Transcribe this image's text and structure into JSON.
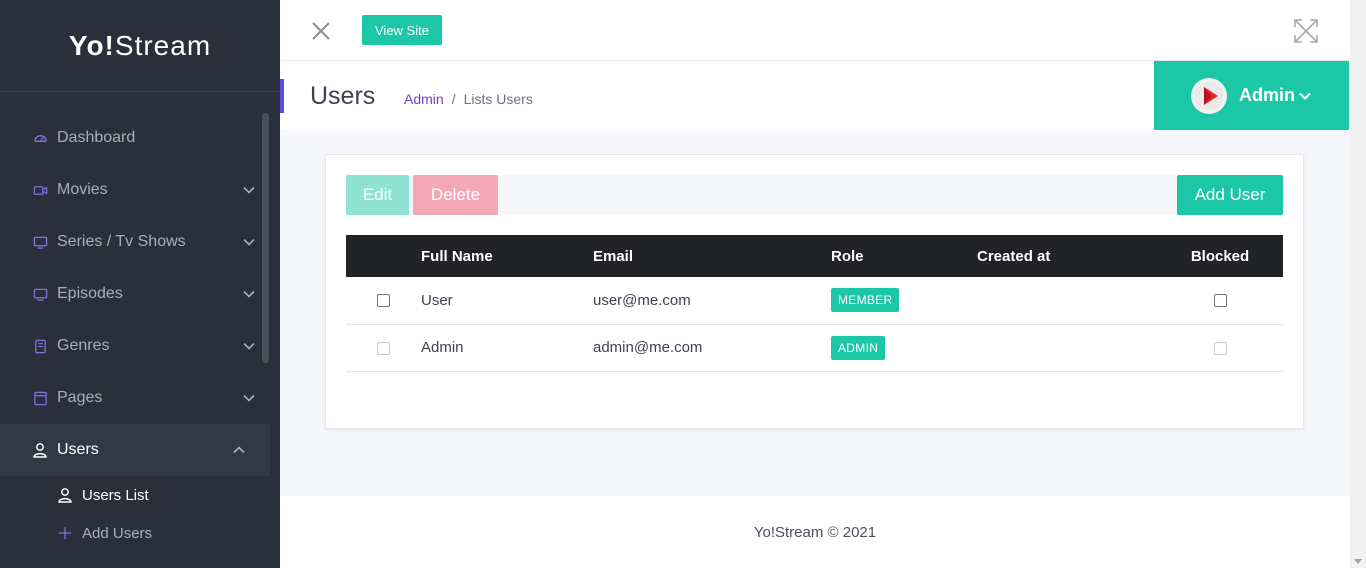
{
  "brand": {
    "bold": "Yo!",
    "rest": "Stream"
  },
  "sidebar": {
    "items": [
      {
        "label": "Dashboard",
        "icon": "dashboard-icon",
        "expandable": false
      },
      {
        "label": "Movies",
        "icon": "video-camera-icon",
        "expandable": true
      },
      {
        "label": "Series / Tv Shows",
        "icon": "monitor-icon",
        "expandable": true
      },
      {
        "label": "Episodes",
        "icon": "monitor-icon",
        "expandable": true
      },
      {
        "label": "Genres",
        "icon": "book-icon",
        "expandable": true
      },
      {
        "label": "Pages",
        "icon": "page-icon",
        "expandable": true
      },
      {
        "label": "Users",
        "icon": "user-icon",
        "expandable": true,
        "expanded": true
      }
    ],
    "subitems": [
      {
        "label": "Users List",
        "icon": "user-icon",
        "active": true
      },
      {
        "label": "Add Users",
        "icon": "plus-icon",
        "active": false
      }
    ]
  },
  "topbar": {
    "view_site_label": "View Site"
  },
  "header": {
    "title": "Users",
    "breadcrumb": {
      "root": "Admin",
      "separator": "/",
      "current": "Lists Users"
    },
    "account_name": "Admin"
  },
  "toolbar": {
    "edit_label": "Edit",
    "delete_label": "Delete",
    "add_label": "Add User"
  },
  "table": {
    "columns": [
      "",
      "Full Name",
      "Email",
      "Role",
      "Created at",
      "Blocked"
    ],
    "rows": [
      {
        "name": "User",
        "email": "user@me.com",
        "role": "MEMBER",
        "created": "",
        "disabled": false
      },
      {
        "name": "Admin",
        "email": "admin@me.com",
        "role": "ADMIN",
        "created": "",
        "disabled": true
      }
    ]
  },
  "footer": {
    "text": "Yo!Stream © 2021"
  },
  "colors": {
    "accent": "#1cc7a7",
    "sidebar": "#2a2f3b",
    "purple": "#6f42c1",
    "danger_light": "#f4a7b4"
  }
}
